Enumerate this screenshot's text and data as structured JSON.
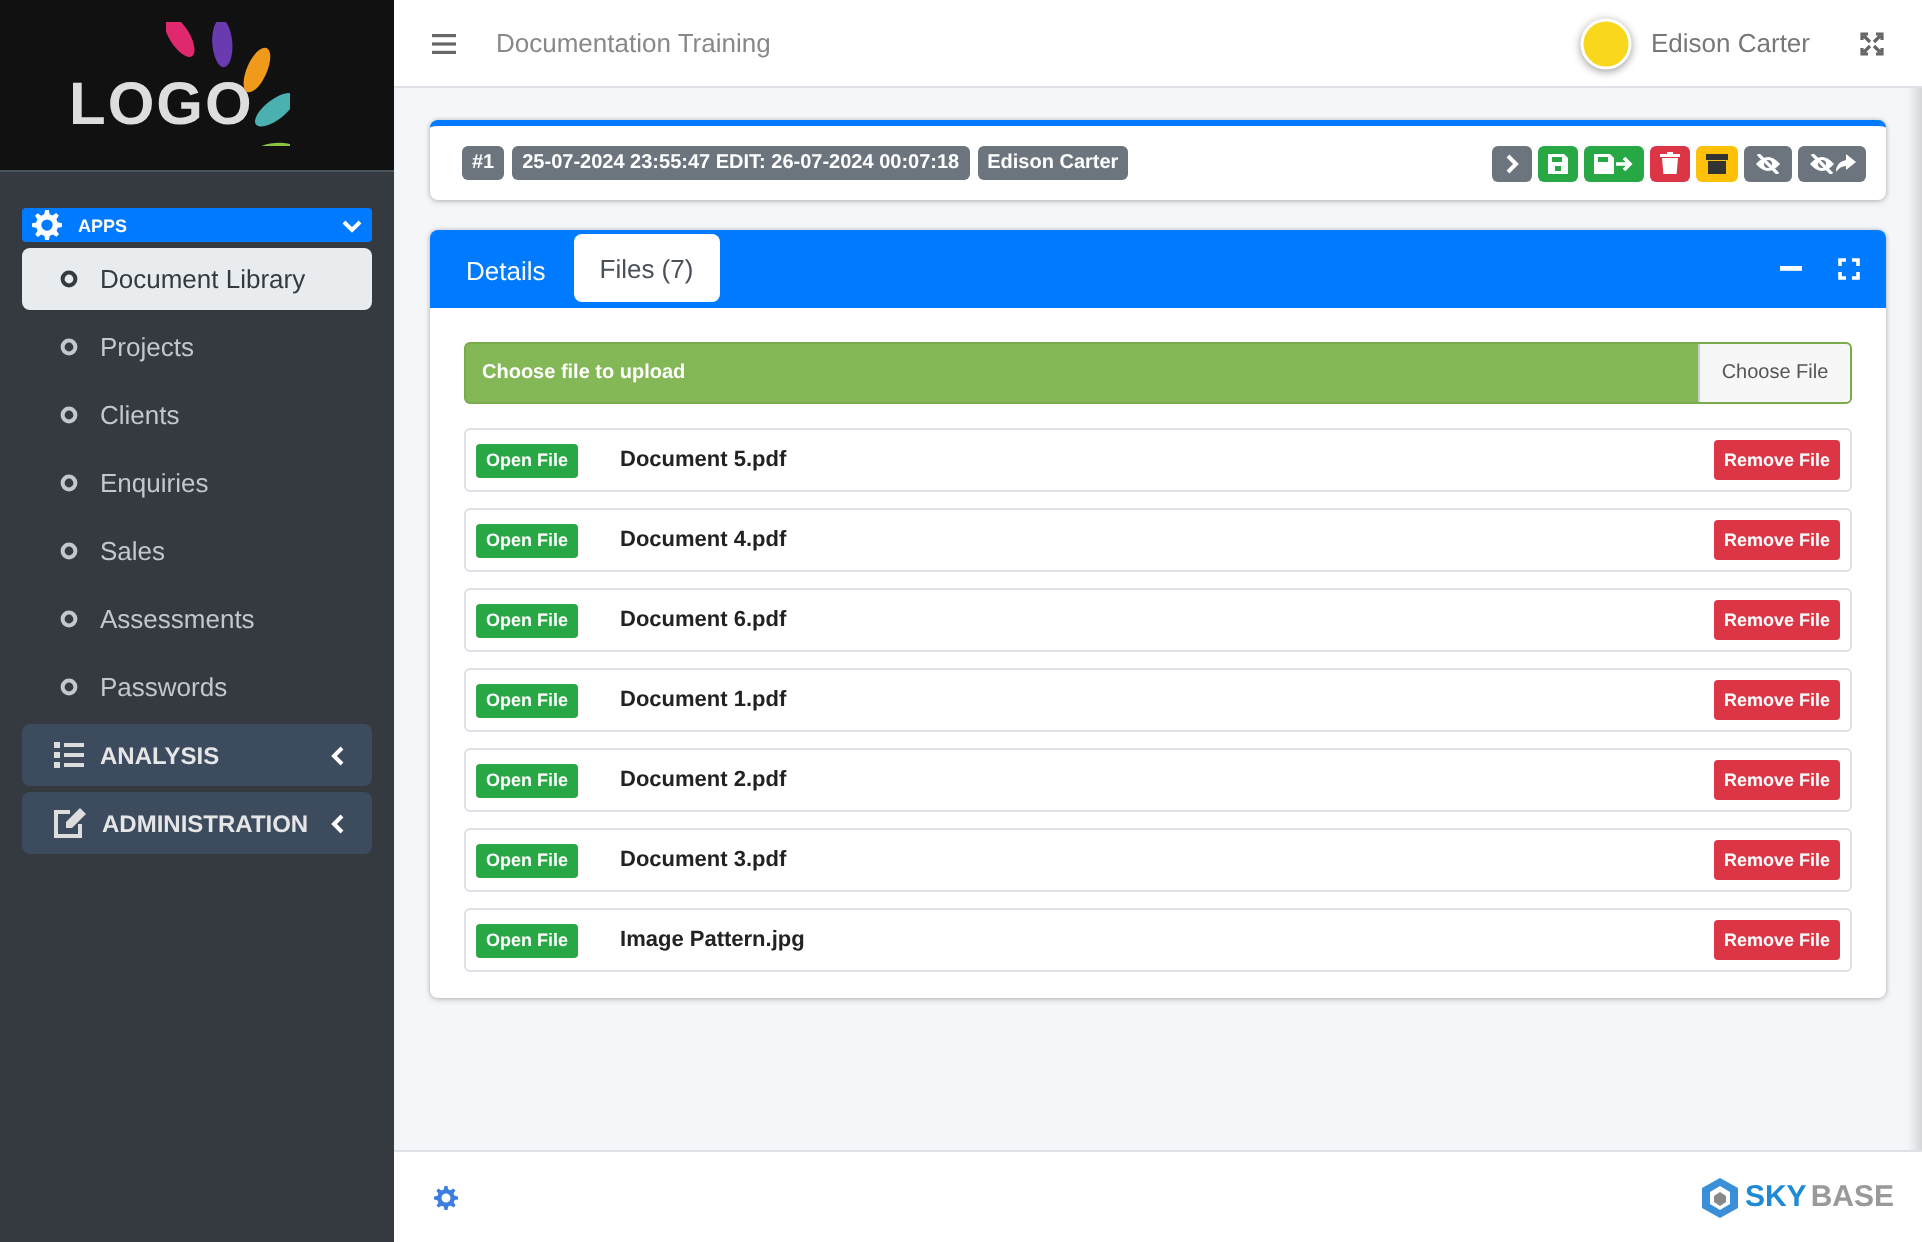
{
  "sidebar": {
    "logo": "LOGO",
    "groups": [
      {
        "label": "APPS",
        "expanded": true,
        "items": [
          {
            "label": "Document Library",
            "selected": true
          },
          {
            "label": "Projects",
            "selected": false
          },
          {
            "label": "Clients",
            "selected": false
          },
          {
            "label": "Enquiries",
            "selected": false
          },
          {
            "label": "Sales",
            "selected": false
          },
          {
            "label": "Assessments",
            "selected": false
          },
          {
            "label": "Passwords",
            "selected": false
          }
        ]
      },
      {
        "label": "ANALYSIS",
        "expanded": false
      },
      {
        "label": "ADMINISTRATION",
        "expanded": false
      }
    ]
  },
  "header": {
    "title": "Documentation Training",
    "user": "Edison Carter"
  },
  "record": {
    "badges": [
      "#1",
      "25-07-2024 23:55:47 EDIT: 26-07-2024 00:07:18",
      "Edison Carter"
    ],
    "actions": [
      {
        "kind": "next",
        "color": "#6c757d"
      },
      {
        "kind": "save",
        "color": "#28a745"
      },
      {
        "kind": "save-next",
        "color": "#28a745"
      },
      {
        "kind": "delete",
        "color": "#dc3545"
      },
      {
        "kind": "archive",
        "color": "#ffc107"
      },
      {
        "kind": "hide",
        "color": "#6c757d"
      },
      {
        "kind": "hide-forward",
        "color": "#6c757d"
      }
    ]
  },
  "tabs": [
    {
      "label": "Details",
      "selected": false
    },
    {
      "label": "Files (7)",
      "selected": true
    }
  ],
  "upload": {
    "label": "Choose file to upload",
    "button": "Choose File"
  },
  "files": [
    {
      "name": "Document 5.pdf",
      "open": "Open File",
      "remove": "Remove File"
    },
    {
      "name": "Document 4.pdf",
      "open": "Open File",
      "remove": "Remove File"
    },
    {
      "name": "Document 6.pdf",
      "open": "Open File",
      "remove": "Remove File"
    },
    {
      "name": "Document 1.pdf",
      "open": "Open File",
      "remove": "Remove File"
    },
    {
      "name": "Document 2.pdf",
      "open": "Open File",
      "remove": "Remove File"
    },
    {
      "name": "Document 3.pdf",
      "open": "Open File",
      "remove": "Remove File"
    },
    {
      "name": "Image Pattern.jpg",
      "open": "Open File",
      "remove": "Remove File"
    }
  ],
  "footer": {
    "brand_primary": "SKY",
    "brand_secondary": "BASE"
  }
}
